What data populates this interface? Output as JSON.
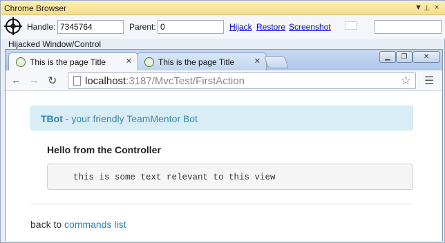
{
  "window": {
    "title": "Chrome Browser",
    "controls": [
      "▼",
      "⊥",
      "×"
    ]
  },
  "toolbar": {
    "handle_label": "Handle:",
    "handle_value": "7345764",
    "parent_label": "Parent:",
    "parent_value": "0",
    "hijack_link": "Hijack",
    "restore_link": "Restore",
    "screenshot_link": "Screenshot",
    "extra_value": ""
  },
  "hijacked_label": "Hijacked Window/Control",
  "tabs": [
    {
      "title": "This is the page Title",
      "active": true
    },
    {
      "title": "This is the page Title",
      "active": false
    }
  ],
  "nav": {
    "url_host": "localhost",
    "url_path": ":3187/MvcTest/FirstAction"
  },
  "page": {
    "alert_brand": "TBot",
    "alert_text": " - your friendly TeamMentor Bot",
    "heading": "Hello from the Controller",
    "pre_text": "this is some text relevant to this view",
    "footer_prefix": "back to ",
    "footer_link": "commands list"
  },
  "colors": {
    "accent": "#2a7fc0",
    "alert_bg": "#d9edf7",
    "titlebar": "#f6dd8a"
  }
}
